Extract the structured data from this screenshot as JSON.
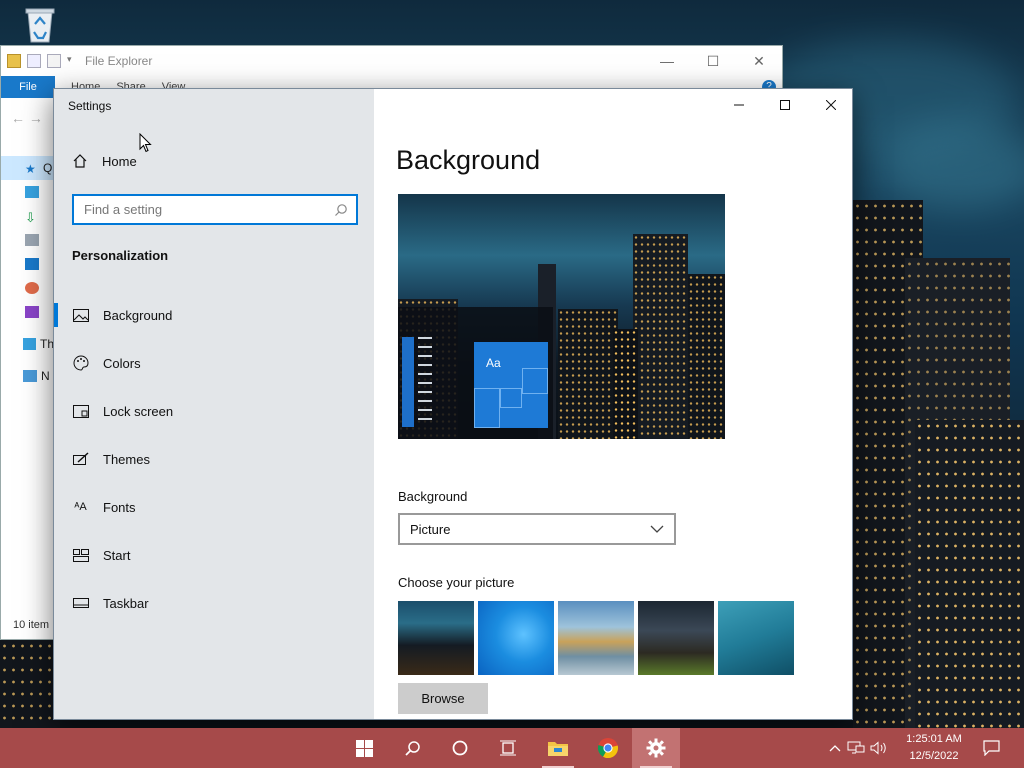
{
  "explorer": {
    "title": "File Explorer",
    "ribbon_tabs": [
      "File",
      "Home",
      "Share",
      "View"
    ],
    "sidebar_labels": [
      "Q",
      "",
      "",
      "",
      "",
      "",
      "",
      "Th",
      "N"
    ],
    "status": "10 item",
    "help": "?"
  },
  "settings": {
    "app_title": "Settings",
    "home_label": "Home",
    "search_placeholder": "Find a setting",
    "section": "Personalization",
    "nav_items": [
      {
        "label": "Background",
        "icon": "picture-icon",
        "active": true
      },
      {
        "label": "Colors",
        "icon": "palette-icon",
        "active": false
      },
      {
        "label": "Lock screen",
        "icon": "lock-screen-icon",
        "active": false
      },
      {
        "label": "Themes",
        "icon": "themes-icon",
        "active": false
      },
      {
        "label": "Fonts",
        "icon": "fonts-icon",
        "active": false
      },
      {
        "label": "Start",
        "icon": "start-icon",
        "active": false
      },
      {
        "label": "Taskbar",
        "icon": "taskbar-icon",
        "active": false
      }
    ],
    "page_title": "Background",
    "preview_tile_text": "Aa",
    "background_label": "Background",
    "background_value": "Picture",
    "choose_label": "Choose your picture",
    "browse_label": "Browse"
  },
  "taskbar": {
    "time": "1:25:01 AM",
    "date": "12/5/2022",
    "pinned": [
      "start-icon",
      "search-icon",
      "cortana-icon",
      "task-view-icon",
      "file-explorer-icon",
      "chrome-icon",
      "settings-icon"
    ]
  },
  "colors": {
    "accent": "#0078d7",
    "taskbar": "#a64a4a",
    "nav_bg": "#e3e6e9"
  }
}
